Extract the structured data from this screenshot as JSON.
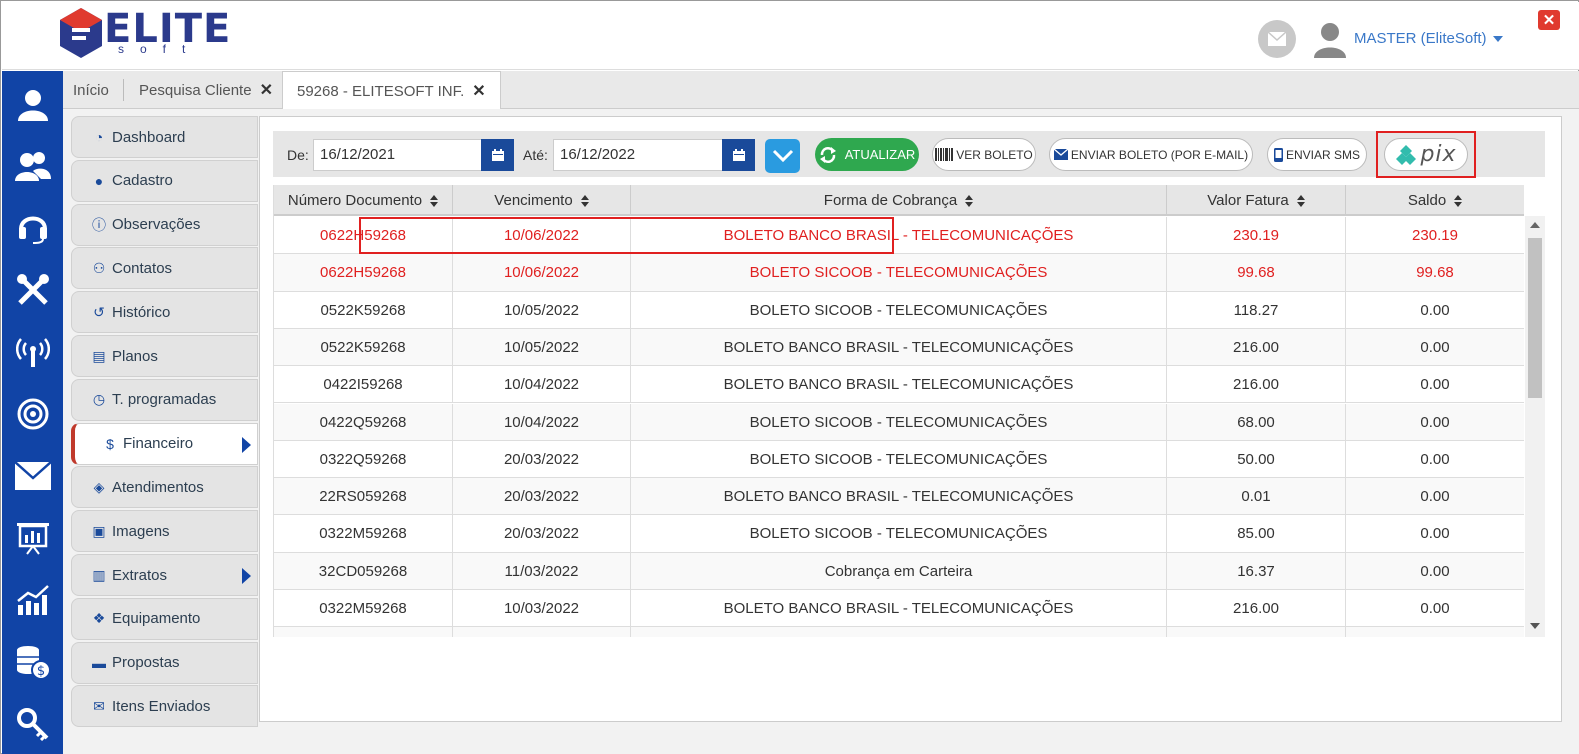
{
  "brand": {
    "name": "ELITE",
    "sub": "soft"
  },
  "header": {
    "user": "MASTER (EliteSoft)"
  },
  "tabs": [
    {
      "label": "Início"
    },
    {
      "label": "Pesquisa Cliente"
    },
    {
      "label": "59268 - ELITESOFT INF."
    }
  ],
  "sidebar_icons": [
    "user-icon",
    "users-icon",
    "headset-icon",
    "tools-icon",
    "antenna-icon",
    "target-icon",
    "mail-icon",
    "presentation-icon",
    "chart-up-icon",
    "database-money-icon",
    "key-icon"
  ],
  "menu": [
    {
      "label": "Dashboard",
      "icon": "dashboard-icon"
    },
    {
      "label": "Cadastro",
      "icon": "user-circle-icon"
    },
    {
      "label": "Observações",
      "icon": "info-icon"
    },
    {
      "label": "Contatos",
      "icon": "users-icon"
    },
    {
      "label": "Histórico",
      "icon": "history-icon"
    },
    {
      "label": "Planos",
      "icon": "list-icon"
    },
    {
      "label": "T. programadas",
      "icon": "clock-icon"
    },
    {
      "label": "Financeiro",
      "icon": "dollar-icon",
      "active": true
    },
    {
      "label": "Atendimentos",
      "icon": "ticket-icon"
    },
    {
      "label": "Imagens",
      "icon": "image-icon"
    },
    {
      "label": "Extratos",
      "icon": "bar-chart-icon"
    },
    {
      "label": "Equipamento",
      "icon": "cubes-icon"
    },
    {
      "label": "Propostas",
      "icon": "briefcase-icon"
    },
    {
      "label": "Itens Enviados",
      "icon": "envelope-open-icon"
    }
  ],
  "filter": {
    "from_label": "De:",
    "from_value": "16/12/2021",
    "to_label": "Até:",
    "to_value": "16/12/2022",
    "refresh_label": "ATUALIZAR",
    "boleto_label": "VER BOLETO",
    "email_label": "ENVIAR BOLETO (POR E-MAIL)",
    "sms_label": "ENVIAR SMS",
    "pix_label": "pix"
  },
  "table": {
    "columns": [
      "Número Documento",
      "Vencimento",
      "Forma de Cobrança",
      "Valor Fatura",
      "Saldo"
    ],
    "rows": [
      {
        "doc": "0622H59268",
        "venc": "10/06/2022",
        "forma": "BOLETO BANCO BRASIL - TELECOMUNICAÇÕES",
        "valor": "230.19",
        "saldo": "230.19",
        "overdue": true
      },
      {
        "doc": "0622H59268",
        "venc": "10/06/2022",
        "forma": "BOLETO SICOOB - TELECOMUNICAÇÕES",
        "valor": "99.68",
        "saldo": "99.68",
        "overdue": true
      },
      {
        "doc": "0522K59268",
        "venc": "10/05/2022",
        "forma": "BOLETO SICOOB - TELECOMUNICAÇÕES",
        "valor": "118.27",
        "saldo": "0.00"
      },
      {
        "doc": "0522K59268",
        "venc": "10/05/2022",
        "forma": "BOLETO BANCO BRASIL - TELECOMUNICAÇÕES",
        "valor": "216.00",
        "saldo": "0.00"
      },
      {
        "doc": "0422I59268",
        "venc": "10/04/2022",
        "forma": "BOLETO BANCO BRASIL - TELECOMUNICAÇÕES",
        "valor": "216.00",
        "saldo": "0.00"
      },
      {
        "doc": "0422Q59268",
        "venc": "10/04/2022",
        "forma": "BOLETO SICOOB - TELECOMUNICAÇÕES",
        "valor": "68.00",
        "saldo": "0.00"
      },
      {
        "doc": "0322Q59268",
        "venc": "20/03/2022",
        "forma": "BOLETO SICOOB - TELECOMUNICAÇÕES",
        "valor": "50.00",
        "saldo": "0.00"
      },
      {
        "doc": "22RS059268",
        "venc": "20/03/2022",
        "forma": "BOLETO BANCO BRASIL - TELECOMUNICAÇÕES",
        "valor": "0.01",
        "saldo": "0.00"
      },
      {
        "doc": "0322M59268",
        "venc": "20/03/2022",
        "forma": "BOLETO SICOOB - TELECOMUNICAÇÕES",
        "valor": "85.00",
        "saldo": "0.00"
      },
      {
        "doc": "32CD059268",
        "venc": "11/03/2022",
        "forma": "Cobrança em Carteira",
        "valor": "16.37",
        "saldo": "0.00"
      },
      {
        "doc": "0322M59268",
        "venc": "10/03/2022",
        "forma": "BOLETO BANCO BRASIL -  TELECOMUNICAÇÕES",
        "valor": "216.00",
        "saldo": "0.00"
      }
    ]
  },
  "colors": {
    "primary": "#1144a6",
    "alert": "#e02020",
    "success": "#2fa84f",
    "accent": "#2a9be0"
  }
}
